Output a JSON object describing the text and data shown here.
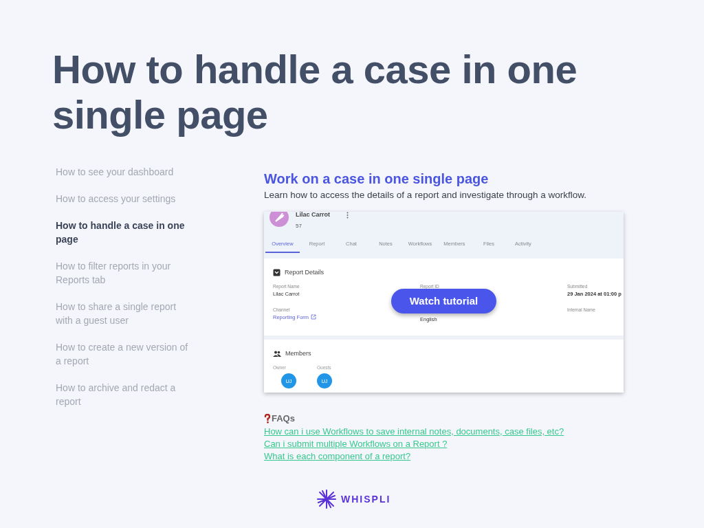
{
  "title": "How to handle a case in one single page",
  "sidebar": {
    "items": [
      {
        "label": "How to see your dashboard",
        "selected": false
      },
      {
        "label": "How to access your settings",
        "selected": false
      },
      {
        "label": "How to handle a case in one page",
        "selected": true
      },
      {
        "label": "How to filter reports in your Reports tab",
        "selected": false
      },
      {
        "label": "How to share a single report with a guest user",
        "selected": false
      },
      {
        "label": "How to create a new version of a report",
        "selected": false
      },
      {
        "label": "How to archive and redact a report",
        "selected": false
      }
    ]
  },
  "lesson": {
    "heading": "Work on a case in one single page",
    "description": "Learn how to access the details of a report and investigate through a workflow.",
    "video": {
      "case_name": "Lilac Carrot",
      "case_number": "57",
      "tabs": [
        {
          "label": "Overview",
          "selected": true
        },
        {
          "label": "Report",
          "selected": false
        },
        {
          "label": "Chat",
          "selected": false
        },
        {
          "label": "Notes",
          "selected": false
        },
        {
          "label": "Workflows",
          "selected": false
        },
        {
          "label": "Members",
          "selected": false
        },
        {
          "label": "Files",
          "selected": false
        },
        {
          "label": "Activity",
          "selected": false
        }
      ],
      "details_title": "Report Details",
      "fields": [
        {
          "label": "Report Name",
          "value": "Lilac Carrot",
          "kind": "text"
        },
        {
          "label": "Report ID"
        },
        {
          "label": "Submitted",
          "value": "29 Jan 2024 at 01:00 p",
          "kind": "text"
        },
        {
          "label": "Channel",
          "value": "Reporting Form",
          "kind": "link"
        },
        {
          "value": "English",
          "kind": "text"
        },
        {
          "label": "Internal Name"
        }
      ],
      "members_title": "Members",
      "members": [
        {
          "role": "Owner",
          "initials": "UJ"
        },
        {
          "role": "Guests",
          "initials": "UJ"
        }
      ],
      "watch_button": "Watch tutorial"
    }
  },
  "faqs": {
    "heading": "FAQs",
    "links": [
      "How can i use Workflows to save internal notes, documents, case files, etc?",
      "Can i submit multiple Workflows on a Report ?",
      "What is each component of a report?"
    ]
  },
  "logo": {
    "text": "WHISPLI"
  }
}
